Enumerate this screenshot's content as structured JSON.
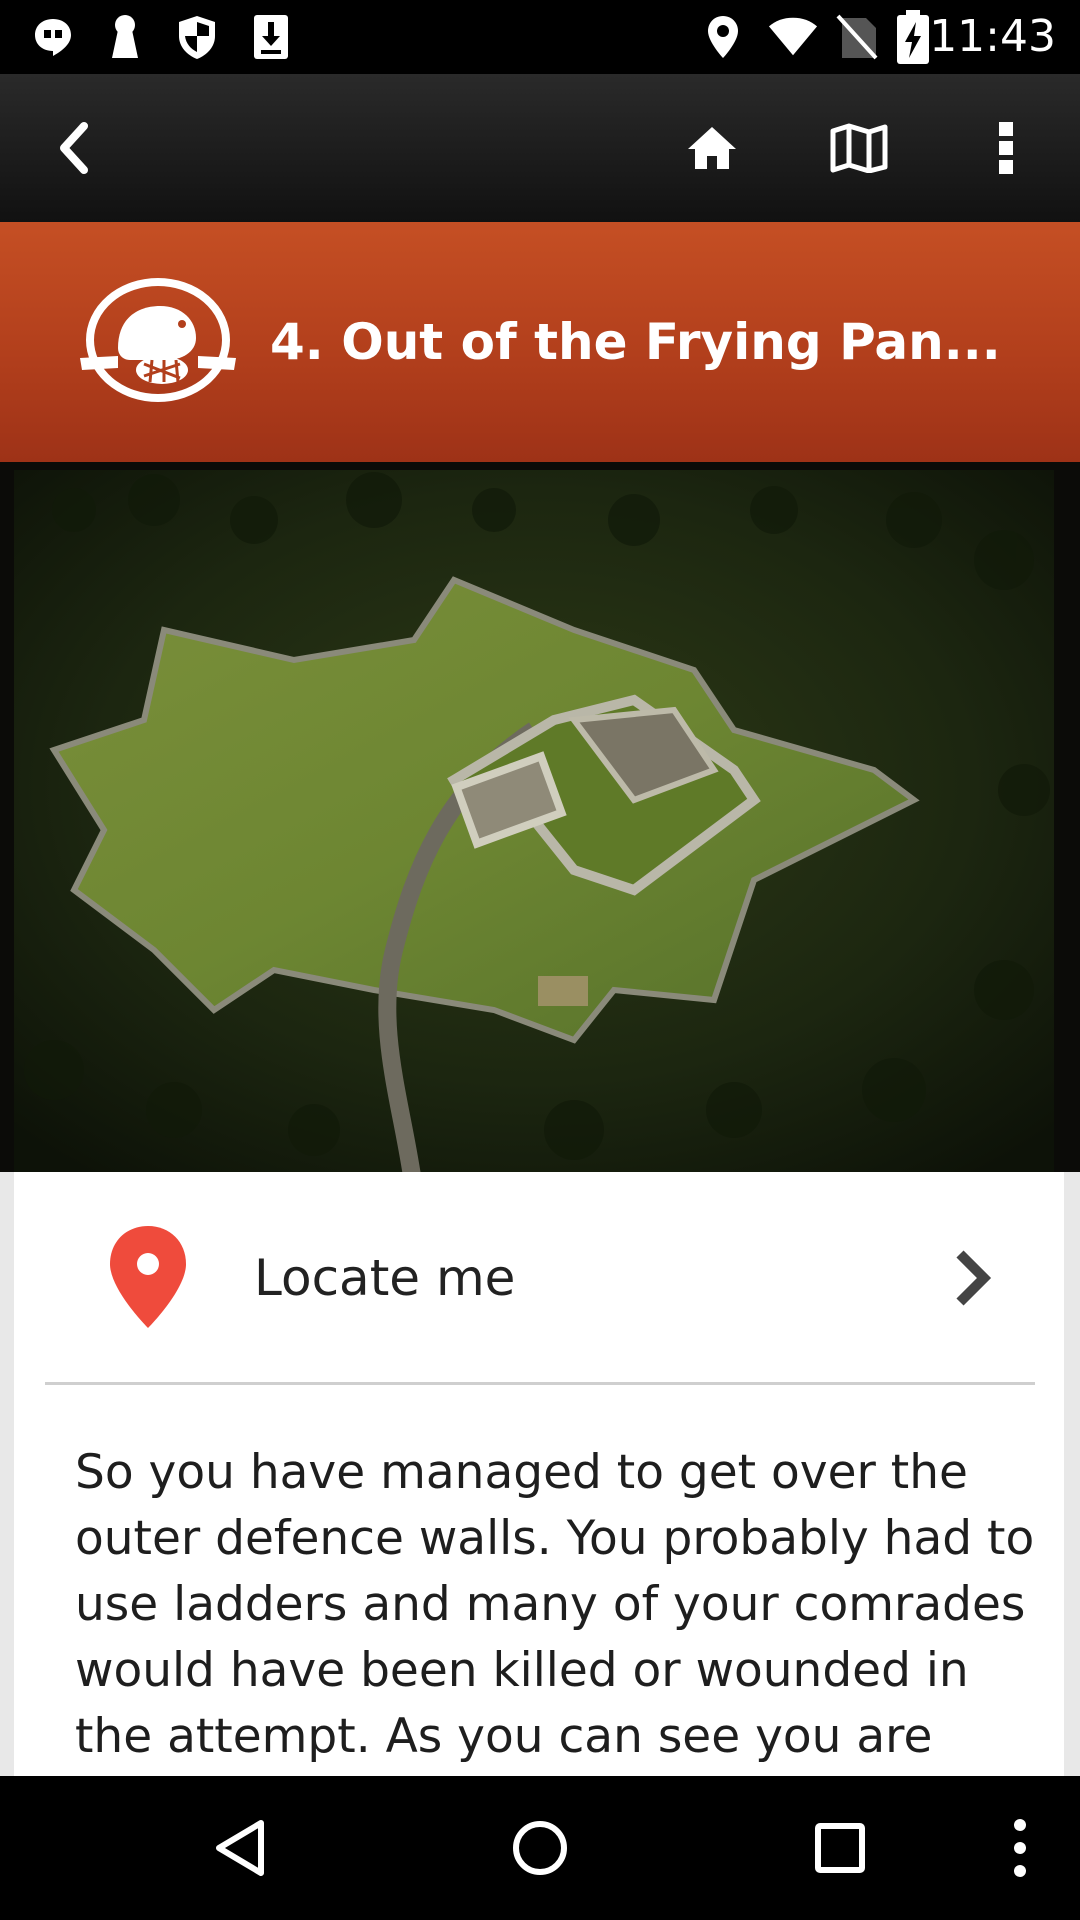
{
  "status_bar": {
    "time": "11:43",
    "icons_left": [
      "hangouts-icon",
      "keyhole-icon",
      "shield-icon",
      "download-icon"
    ],
    "icons_right": [
      "location-icon",
      "wifi-icon",
      "no-sim-icon",
      "battery-charging-icon"
    ]
  },
  "action_bar": {
    "buttons": [
      "back-icon",
      "home-icon",
      "map-icon",
      "overflow-menu-icon"
    ]
  },
  "banner": {
    "title": "4. Out of the Frying Pan..."
  },
  "locate": {
    "label": "Locate me"
  },
  "article": {
    "text": "So you have managed to get over the outer defence walls. You probably had to use ladders and many of your comrades would have been killed or wounded in the attempt. As you can see you are now"
  },
  "nav_bar": {
    "buttons": [
      "back-triangle-icon",
      "home-circle-icon",
      "recents-square-icon",
      "more-dots-icon"
    ]
  },
  "colors": {
    "banner": "#b8431f",
    "pin": "#ef4b3c",
    "action_bar": "#1c1c1c"
  }
}
